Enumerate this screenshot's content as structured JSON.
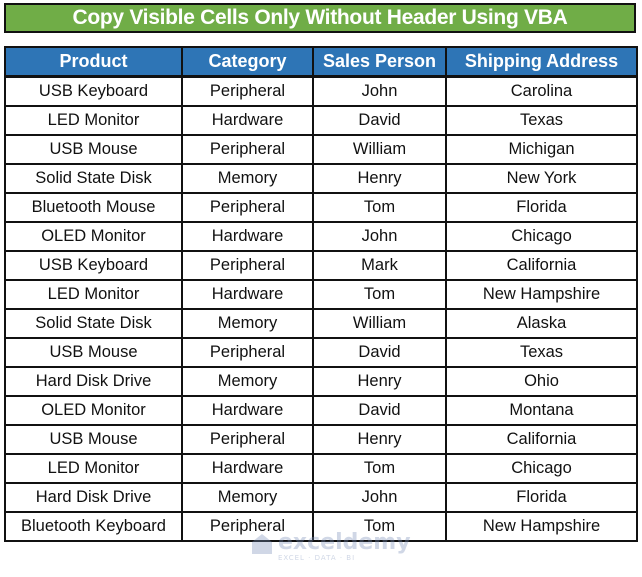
{
  "title": "Copy Visible Cells Only Without Header Using VBA",
  "colors": {
    "title_bg": "#70ad47",
    "header_bg": "#2e75b6",
    "border": "#111111"
  },
  "table": {
    "headers": [
      "Product",
      "Category",
      "Sales Person",
      "Shipping Address"
    ],
    "rows": [
      [
        "USB Keyboard",
        "Peripheral",
        "John",
        "Carolina"
      ],
      [
        "LED Monitor",
        "Hardware",
        "David",
        "Texas"
      ],
      [
        "USB Mouse",
        "Peripheral",
        "William",
        "Michigan"
      ],
      [
        "Solid State Disk",
        "Memory",
        "Henry",
        "New York"
      ],
      [
        "Bluetooth Mouse",
        "Peripheral",
        "Tom",
        "Florida"
      ],
      [
        "OLED Monitor",
        "Hardware",
        "John",
        "Chicago"
      ],
      [
        "USB Keyboard",
        "Peripheral",
        "Mark",
        "California"
      ],
      [
        "LED Monitor",
        "Hardware",
        "Tom",
        "New Hampshire"
      ],
      [
        "Solid State Disk",
        "Memory",
        "William",
        "Alaska"
      ],
      [
        "USB Mouse",
        "Peripheral",
        "David",
        "Texas"
      ],
      [
        "Hard Disk Drive",
        "Memory",
        "Henry",
        "Ohio"
      ],
      [
        "OLED Monitor",
        "Hardware",
        "David",
        "Montana"
      ],
      [
        "USB Mouse",
        "Peripheral",
        "Henry",
        "California"
      ],
      [
        "LED Monitor",
        "Hardware",
        "Tom",
        "Chicago"
      ],
      [
        "Hard Disk Drive",
        "Memory",
        "John",
        "Florida"
      ],
      [
        "Bluetooth Keyboard",
        "Peripheral",
        "Tom",
        "New Hampshire"
      ]
    ]
  },
  "watermark": {
    "name": "exceldemy",
    "tagline": "EXCEL · DATA · BI",
    "icon": "exceldemy-logo-icon"
  }
}
